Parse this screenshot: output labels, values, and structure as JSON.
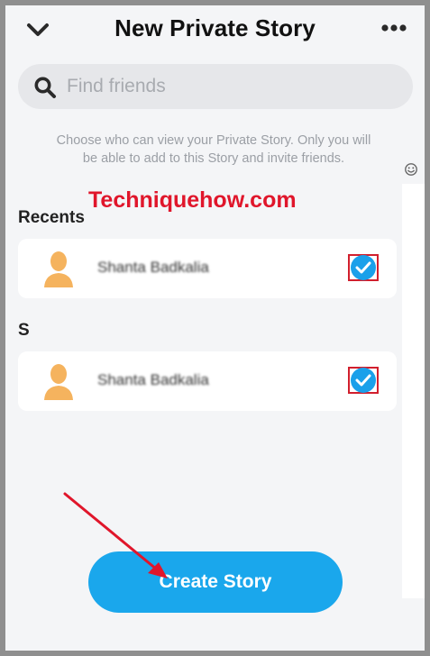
{
  "header": {
    "back_icon": "chevron-down-icon",
    "title": "New Private Story",
    "more_icon": "more-horizontal-icon"
  },
  "search": {
    "icon": "search-icon",
    "placeholder": "Find friends",
    "value": ""
  },
  "description": "Choose who can view your Private Story. Only you will be able to add to this Story and invite friends.",
  "watermark": "Techniquehow.com",
  "sections": [
    {
      "label": "Recents",
      "friends": [
        {
          "name": "Shanta Badkalia",
          "avatar_icon": "bitmoji-avatar-icon",
          "selected": true
        }
      ]
    },
    {
      "label": "S",
      "friends": [
        {
          "name": "Shanta Badkalia",
          "avatar_icon": "bitmoji-avatar-icon",
          "selected": true
        }
      ]
    }
  ],
  "create_button": {
    "label": "Create Story"
  },
  "colors": {
    "accent": "#1aa7ec",
    "checkmark": "#1aa0ea",
    "annotation": "#d11f2d",
    "avatar": "#f5b35e"
  }
}
